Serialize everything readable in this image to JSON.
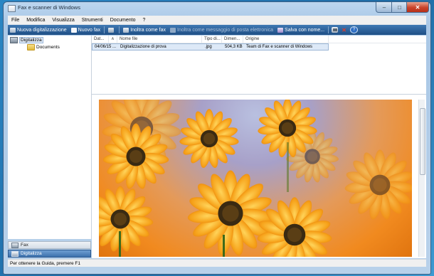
{
  "window": {
    "title": "Fax e scanner di Windows",
    "minimize_glyph": "–",
    "maximize_glyph": "□",
    "close_glyph": "✕"
  },
  "menu": [
    "File",
    "Modifica",
    "Visualizza",
    "Strumenti",
    "Documento",
    "?"
  ],
  "toolbar": {
    "new_scan": "Nuova digitalizzazione",
    "new_fax": "Nuovo fax",
    "forward_fax": "Inoltra come fax",
    "forward_email": "Inoltra come messaggio di posta elettronica",
    "save_as": "Salva con nome...",
    "delete_glyph": "✕",
    "help_glyph": "?"
  },
  "tree": {
    "root": "Digitalizza",
    "child": "Documents"
  },
  "nav_tabs": {
    "fax": "Fax",
    "scan": "Digitalizza"
  },
  "list": {
    "columns": [
      "Dat...",
      "∧",
      "Nome file",
      "Tipo di...",
      "Dimen...",
      "Origine"
    ],
    "rows": [
      {
        "date": "04/06/15 ...",
        "name": "Digitalizzazione di prova",
        "type": ".jpg",
        "size": "504,3 KB",
        "source": "Team di Fax e scanner di Windows"
      }
    ]
  },
  "status": {
    "text": "Per ottenere la Guida, premere F1"
  },
  "colors": {
    "toolbar": "#2d62a0",
    "selection": "#dde9f7",
    "petal": "#f6a21a",
    "flower_center": "#3a2a12"
  }
}
